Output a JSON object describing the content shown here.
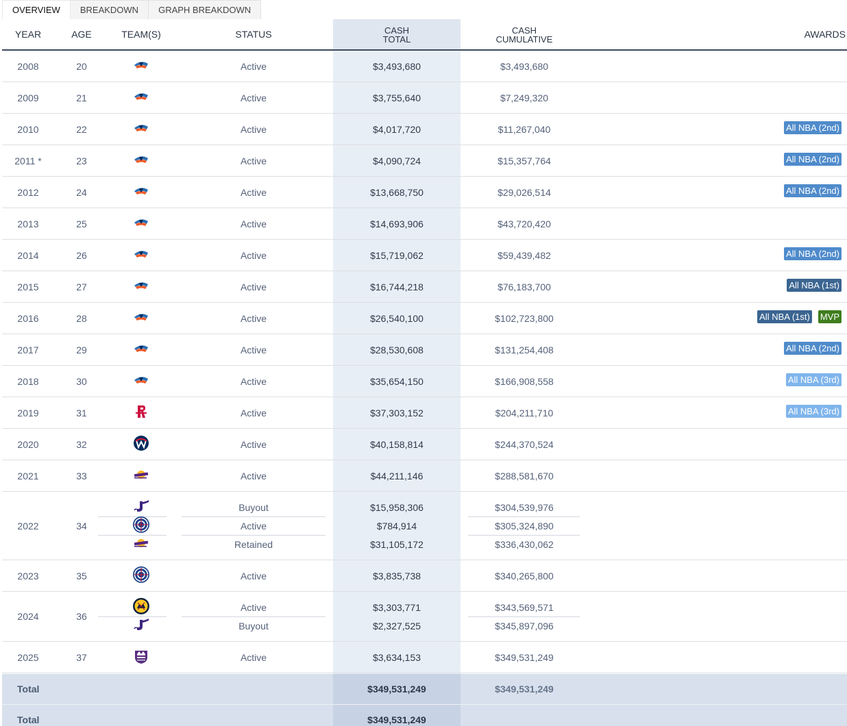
{
  "tabs": [
    "OVERVIEW",
    "BREAKDOWN",
    "GRAPH BREAKDOWN"
  ],
  "active_tab": 0,
  "headers": {
    "year": "YEAR",
    "age": "AGE",
    "teams": "TEAM(S)",
    "status": "STATUS",
    "cash_total_1": "CASH",
    "cash_total_2": "TOTAL",
    "cash_cum_1": "CASH",
    "cash_cum_2": "CUMULATIVE",
    "awards": "AWARDS"
  },
  "colors": {
    "header_rule": "#3c4a5e",
    "cash_column": "#e8eef6",
    "award_2nd": "#4f8bcb",
    "award_1st": "#3b6591",
    "award_3rd": "#7fb5ec",
    "award_mvp": "#3f7e1f",
    "total_band": "#d7e0ec"
  },
  "rows": [
    {
      "year": "2008",
      "age": "20",
      "lines": [
        {
          "team": "okc-thunder-logo",
          "status": "Active",
          "cash": "$3,493,680",
          "cum": "$3,493,680"
        }
      ],
      "awards": []
    },
    {
      "year": "2009",
      "age": "21",
      "lines": [
        {
          "team": "okc-thunder-logo",
          "status": "Active",
          "cash": "$3,755,640",
          "cum": "$7,249,320"
        }
      ],
      "awards": []
    },
    {
      "year": "2010",
      "age": "22",
      "lines": [
        {
          "team": "okc-thunder-logo",
          "status": "Active",
          "cash": "$4,017,720",
          "cum": "$11,267,040"
        }
      ],
      "awards": [
        {
          "label": "All NBA (2nd)",
          "kind": "2nd"
        }
      ]
    },
    {
      "year": "2011 *",
      "age": "23",
      "lines": [
        {
          "team": "okc-thunder-logo",
          "status": "Active",
          "cash": "$4,090,724",
          "cum": "$15,357,764"
        }
      ],
      "awards": [
        {
          "label": "All NBA (2nd)",
          "kind": "2nd"
        }
      ]
    },
    {
      "year": "2012",
      "age": "24",
      "lines": [
        {
          "team": "okc-thunder-logo",
          "status": "Active",
          "cash": "$13,668,750",
          "cum": "$29,026,514"
        }
      ],
      "awards": [
        {
          "label": "All NBA (2nd)",
          "kind": "2nd"
        }
      ]
    },
    {
      "year": "2013",
      "age": "25",
      "lines": [
        {
          "team": "okc-thunder-logo",
          "status": "Active",
          "cash": "$14,693,906",
          "cum": "$43,720,420"
        }
      ],
      "awards": []
    },
    {
      "year": "2014",
      "age": "26",
      "lines": [
        {
          "team": "okc-thunder-logo",
          "status": "Active",
          "cash": "$15,719,062",
          "cum": "$59,439,482"
        }
      ],
      "awards": [
        {
          "label": "All NBA (2nd)",
          "kind": "2nd"
        }
      ]
    },
    {
      "year": "2015",
      "age": "27",
      "lines": [
        {
          "team": "okc-thunder-logo",
          "status": "Active",
          "cash": "$16,744,218",
          "cum": "$76,183,700"
        }
      ],
      "awards": [
        {
          "label": "All NBA (1st)",
          "kind": "1st"
        }
      ]
    },
    {
      "year": "2016",
      "age": "28",
      "lines": [
        {
          "team": "okc-thunder-logo",
          "status": "Active",
          "cash": "$26,540,100",
          "cum": "$102,723,800"
        }
      ],
      "awards": [
        {
          "label": "All NBA (1st)",
          "kind": "1st"
        },
        {
          "label": "MVP",
          "kind": "mvp"
        }
      ]
    },
    {
      "year": "2017",
      "age": "29",
      "lines": [
        {
          "team": "okc-thunder-logo",
          "status": "Active",
          "cash": "$28,530,608",
          "cum": "$131,254,408"
        }
      ],
      "awards": [
        {
          "label": "All NBA (2nd)",
          "kind": "2nd"
        }
      ]
    },
    {
      "year": "2018",
      "age": "30",
      "lines": [
        {
          "team": "okc-thunder-logo",
          "status": "Active",
          "cash": "$35,654,150",
          "cum": "$166,908,558"
        }
      ],
      "awards": [
        {
          "label": "All NBA (3rd)",
          "kind": "3rd"
        }
      ]
    },
    {
      "year": "2019",
      "age": "31",
      "lines": [
        {
          "team": "houston-rockets-logo",
          "status": "Active",
          "cash": "$37,303,152",
          "cum": "$204,211,710"
        }
      ],
      "awards": [
        {
          "label": "All NBA (3rd)",
          "kind": "3rd"
        }
      ]
    },
    {
      "year": "2020",
      "age": "32",
      "lines": [
        {
          "team": "washington-wizards-logo",
          "status": "Active",
          "cash": "$40,158,814",
          "cum": "$244,370,524"
        }
      ],
      "awards": []
    },
    {
      "year": "2021",
      "age": "33",
      "lines": [
        {
          "team": "los-angeles-lakers-logo",
          "status": "Active",
          "cash": "$44,211,146",
          "cum": "$288,581,670"
        }
      ],
      "awards": []
    },
    {
      "year": "2022",
      "age": "34",
      "lines": [
        {
          "team": "utah-jazz-logo",
          "status": "Buyout",
          "cash": "$15,958,306",
          "cum": "$304,539,976"
        },
        {
          "team": "la-clippers-logo",
          "status": "Active",
          "cash": "$784,914",
          "cum": "$305,324,890"
        },
        {
          "team": "los-angeles-lakers-logo",
          "status": "Retained",
          "cash": "$31,105,172",
          "cum": "$336,430,062"
        }
      ],
      "awards": []
    },
    {
      "year": "2023",
      "age": "35",
      "lines": [
        {
          "team": "la-clippers-logo",
          "status": "Active",
          "cash": "$3,835,738",
          "cum": "$340,265,800"
        }
      ],
      "awards": []
    },
    {
      "year": "2024",
      "age": "36",
      "lines": [
        {
          "team": "denver-nuggets-logo",
          "status": "Active",
          "cash": "$3,303,771",
          "cum": "$343,569,571"
        },
        {
          "team": "utah-jazz-logo",
          "status": "Buyout",
          "cash": "$2,327,525",
          "cum": "$345,897,096"
        }
      ],
      "awards": []
    },
    {
      "year": "2025",
      "age": "37",
      "lines": [
        {
          "team": "sacramento-kings-logo",
          "status": "Active",
          "cash": "$3,634,153",
          "cum": "$349,531,249"
        }
      ],
      "awards": []
    }
  ],
  "totals": [
    {
      "label": "Total",
      "cash": "$349,531,249",
      "cum": "$349,531,249"
    },
    {
      "label": "Total",
      "cash": "$349,531,249",
      "cum": ""
    }
  ]
}
